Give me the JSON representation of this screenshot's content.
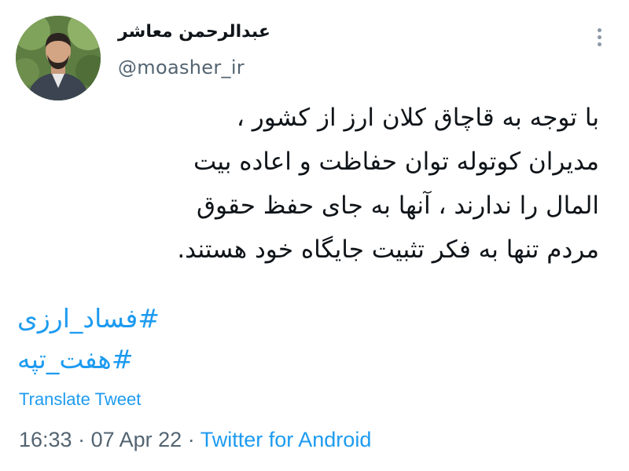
{
  "author": {
    "display_name": "عبدالرحمن معاشر",
    "handle": "@moasher_ir"
  },
  "tweet": {
    "lines": [
      "با توجه به قاچاق کلان ارز از کشور ،",
      "مدیران کوتوله توان حفاظت و اعاده بیت",
      "المال را ندارند ، آنها به جای حفظ حقوق",
      "مردم تنها به فکر تثبیت جایگاه خود هستند."
    ],
    "hashtags": [
      "#فساد_ارزی",
      "#هفت_تپه"
    ],
    "translate_label": "Translate Tweet"
  },
  "meta": {
    "time": "16:33",
    "separator_1": "·",
    "date": "07 Apr 22",
    "separator_2": "·",
    "source": "Twitter for Android"
  },
  "icons": {
    "more": "more-vertical-icon"
  },
  "colors": {
    "link": "#1d9bf0",
    "text": "#0f1419",
    "secondary": "#536471"
  }
}
